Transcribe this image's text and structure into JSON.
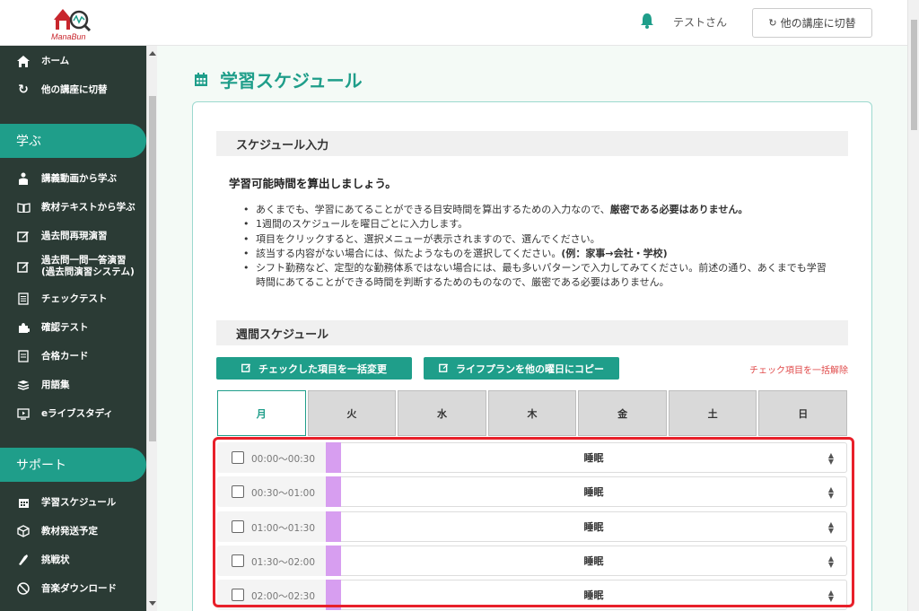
{
  "header": {
    "logo_text": "ManaBun",
    "user_name": "テストさん",
    "switch_course_label": "他の講座に切替"
  },
  "sidebar": {
    "top_items": [
      {
        "icon": "home-icon",
        "label": "ホーム"
      },
      {
        "icon": "refresh-icon",
        "label": "他の講座に切替"
      }
    ],
    "learn_section": "学ぶ",
    "learn_items": [
      {
        "icon": "lecture-video-icon",
        "label": "講義動画から学ぶ"
      },
      {
        "icon": "book-icon",
        "label": "教材テキストから学ぶ"
      },
      {
        "icon": "edit-icon",
        "label": "過去問再現演習"
      },
      {
        "icon": "edit-icon",
        "label": "過去問一問一答演習\n(過去問演習システム)"
      },
      {
        "icon": "checklist-icon",
        "label": "チェックテスト"
      },
      {
        "icon": "puzzle-icon",
        "label": "確認テスト"
      },
      {
        "icon": "card-icon",
        "label": "合格カード"
      },
      {
        "icon": "glossary-icon",
        "label": "用語集"
      },
      {
        "icon": "live-monitor-icon",
        "label": "eライブスタディ"
      }
    ],
    "support_section": "サポート",
    "support_items": [
      {
        "icon": "calendar-icon",
        "label": "学習スケジュール"
      },
      {
        "icon": "package-icon",
        "label": "教材発送予定"
      },
      {
        "icon": "challenge-icon",
        "label": "挑戦状"
      },
      {
        "icon": "music-download-icon",
        "label": "音楽ダウンロード"
      }
    ]
  },
  "main": {
    "page_title": "学習スケジュール",
    "schedule_input_heading": "スケジュール入力",
    "lead": "学習可能時間を算出しましょう。",
    "bullets": [
      {
        "pre": "あくまでも、学習にあてることができる目安時間を算出するための入力なので、",
        "bold": "厳密である必要はありません。",
        "post": ""
      },
      {
        "pre": "1週間のスケジュールを曜日ごとに入力します。",
        "bold": "",
        "post": ""
      },
      {
        "pre": "項目をクリックすると、選択メニューが表示されますので、選んでください。",
        "bold": "",
        "post": ""
      },
      {
        "pre": "該当する内容がない場合には、似たようなものを選択してください。",
        "bold": "(例：家事→会社・学校)",
        "post": ""
      },
      {
        "pre": "シフト勤務など、定型的な勤務体系ではない場合には、最も多いパターンで入力してみてください。前述の通り、あくまでも学習時間にあてることができる時間を判断するためのものなので、厳密である必要はありません。",
        "bold": "",
        "post": ""
      }
    ],
    "weekly_heading": "週間スケジュール",
    "bulk_change_label": "チェックした項目を一括変更",
    "copy_label": "ライフプランを他の曜日にコピー",
    "uncheck_all_label": "チェック項目を一括解除",
    "days": [
      "月",
      "火",
      "水",
      "木",
      "金",
      "土",
      "日"
    ],
    "active_day": "月",
    "rows": [
      {
        "time": "00:00〜00:30",
        "value": "睡眠"
      },
      {
        "time": "00:30〜01:00",
        "value": "睡眠"
      },
      {
        "time": "01:00〜01:30",
        "value": "睡眠"
      },
      {
        "time": "01:30〜02:00",
        "value": "睡眠"
      },
      {
        "time": "02:00〜02:30",
        "value": "睡眠"
      }
    ],
    "sleep_color": "#d79ef0",
    "accent_color": "#1f9e8a",
    "highlight_color": "#e8202a"
  }
}
